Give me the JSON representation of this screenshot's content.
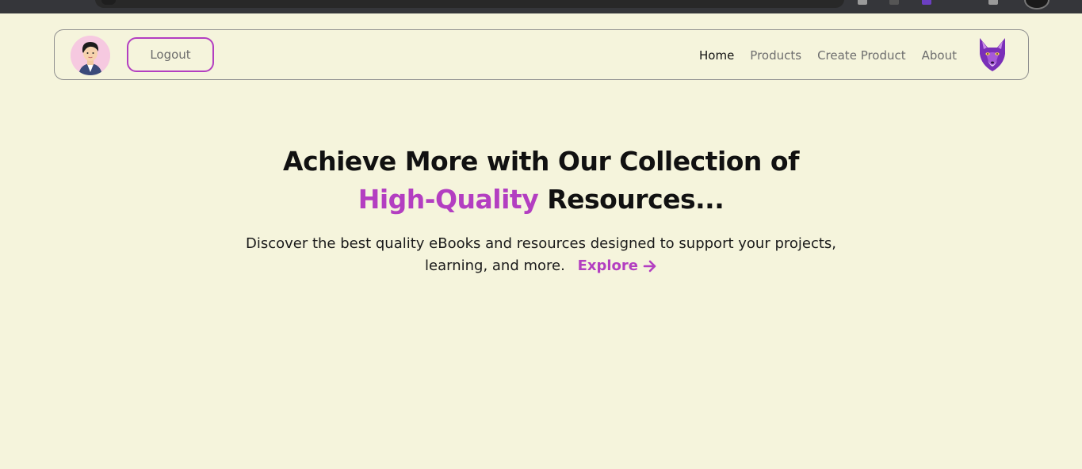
{
  "colors": {
    "background": "#f5f4dc",
    "accent": "#b33ec1",
    "nav_border": "#8f8f8f",
    "text_dark": "#111111",
    "text_muted": "#6e6e6e"
  },
  "header": {
    "user_avatar_icon": "user-avatar-icon",
    "logout_label": "Logout",
    "nav": [
      {
        "label": "Home",
        "active": true
      },
      {
        "label": "Products",
        "active": false
      },
      {
        "label": "Create Product",
        "active": false
      },
      {
        "label": "About",
        "active": false
      }
    ],
    "brand_logo_icon": "purple-fox-logo-icon"
  },
  "hero": {
    "title_line1": "Achieve More with Our Collection of",
    "title_accent": "High-Quality",
    "title_rest": " Resources...",
    "subtitle_line1": "Discover the best quality eBooks and resources designed to support your projects,",
    "subtitle_line2": "learning, and more.",
    "explore_label": "Explore",
    "explore_icon": "arrow-right-icon"
  }
}
